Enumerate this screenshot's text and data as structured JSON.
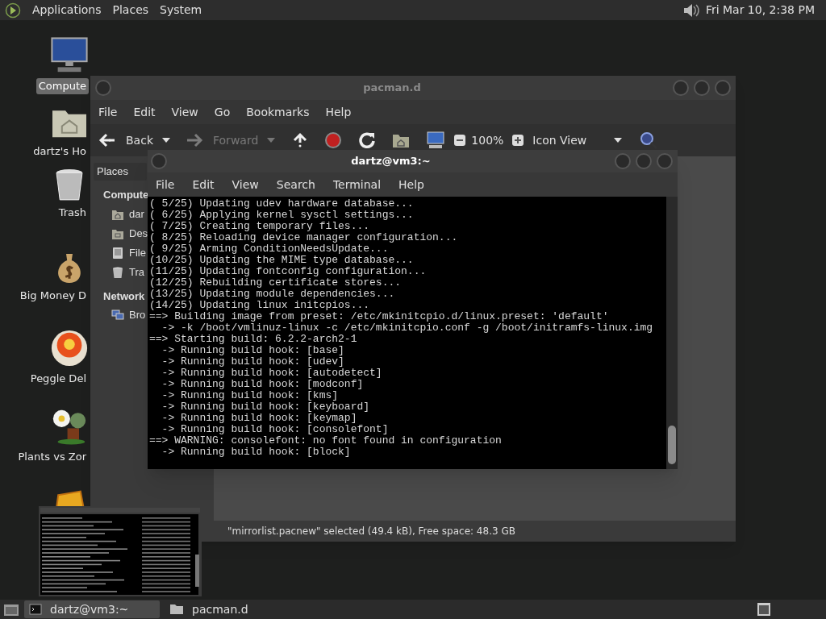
{
  "top_panel": {
    "menus": [
      "Applications",
      "Places",
      "System"
    ],
    "clock": "Fri Mar 10, 2:38 PM"
  },
  "desktop_icons": [
    {
      "kind": "computer",
      "label": "Compute",
      "selected": true
    },
    {
      "kind": "home",
      "label": "dartz's Ho",
      "selected": false
    },
    {
      "kind": "trash",
      "label": "Trash",
      "selected": false
    },
    {
      "kind": "money",
      "label": "Big Money D",
      "selected": false
    },
    {
      "kind": "ball",
      "label": "Peggle Del",
      "selected": false
    },
    {
      "kind": "plant",
      "label": "Plants vs Zor",
      "selected": false
    },
    {
      "kind": "gold"
    }
  ],
  "file_manager": {
    "title": "pacman.d",
    "menu": [
      "File",
      "Edit",
      "View",
      "Go",
      "Bookmarks",
      "Help"
    ],
    "toolbar": [
      {
        "kind": "back",
        "label": "Back",
        "disabled": false
      },
      {
        "kind": "dropdown",
        "disabled": false
      },
      {
        "kind": "forward",
        "label": "Forward",
        "disabled": true
      },
      {
        "kind": "dropdown",
        "disabled": true
      },
      {
        "kind": "up",
        "disabled": false
      },
      {
        "kind": "stop",
        "disabled": false
      },
      {
        "kind": "reload",
        "disabled": false
      },
      {
        "kind": "home",
        "disabled": false
      },
      {
        "kind": "computer",
        "disabled": false
      },
      {
        "kind": "zoom_out",
        "disabled": false
      },
      {
        "kind": "zoom_level",
        "label": "100%",
        "disabled": false
      },
      {
        "kind": "zoom_in",
        "disabled": false
      },
      {
        "kind": "view_select",
        "label": "Icon View",
        "disabled": false
      },
      {
        "kind": "search",
        "disabled": false
      }
    ],
    "sidebar": {
      "selector": "Places",
      "sections": [
        {
          "title": "Compute",
          "items": [
            {
              "kind": "home",
              "label": "dar"
            },
            {
              "kind": "desktop",
              "label": "Des"
            },
            {
              "kind": "drive",
              "label": "File"
            },
            {
              "kind": "trash",
              "label": "Tra"
            }
          ]
        },
        {
          "title": "Network",
          "items": [
            {
              "kind": "network",
              "label": "Bro"
            }
          ]
        }
      ]
    },
    "status": "\"mirrorlist.pacnew\" selected (49.4 kB), Free space: 48.3 GB"
  },
  "terminal": {
    "title": "dartz@vm3:~",
    "menu": [
      "File",
      "Edit",
      "View",
      "Search",
      "Terminal",
      "Help"
    ],
    "lines": [
      "( 5/25) Updating udev hardware database...",
      "( 6/25) Applying kernel sysctl settings...",
      "( 7/25) Creating temporary files...",
      "( 8/25) Reloading device manager configuration...",
      "( 9/25) Arming ConditionNeedsUpdate...",
      "(10/25) Updating the MIME type database...",
      "(11/25) Updating fontconfig configuration...",
      "(12/25) Rebuilding certificate stores...",
      "(13/25) Updating module dependencies...",
      "(14/25) Updating linux initcpios...",
      "==> Building image from preset: /etc/mkinitcpio.d/linux.preset: 'default'",
      "  -> -k /boot/vmlinuz-linux -c /etc/mkinitcpio.conf -g /boot/initramfs-linux.img",
      "==> Starting build: 6.2.2-arch2-1",
      "  -> Running build hook: [base]",
      "  -> Running build hook: [udev]",
      "  -> Running build hook: [autodetect]",
      "  -> Running build hook: [modconf]",
      "  -> Running build hook: [kms]",
      "  -> Running build hook: [keyboard]",
      "  -> Running build hook: [keymap]",
      "  -> Running build hook: [consolefont]",
      "==> WARNING: consolefont: no font found in configuration",
      "  -> Running build hook: [block]"
    ]
  },
  "taskbar": {
    "tasks": [
      {
        "kind": "terminal",
        "label": "dartz@vm3:~",
        "selected": true
      },
      {
        "kind": "folder",
        "label": "pacman.d",
        "selected": false
      }
    ]
  }
}
